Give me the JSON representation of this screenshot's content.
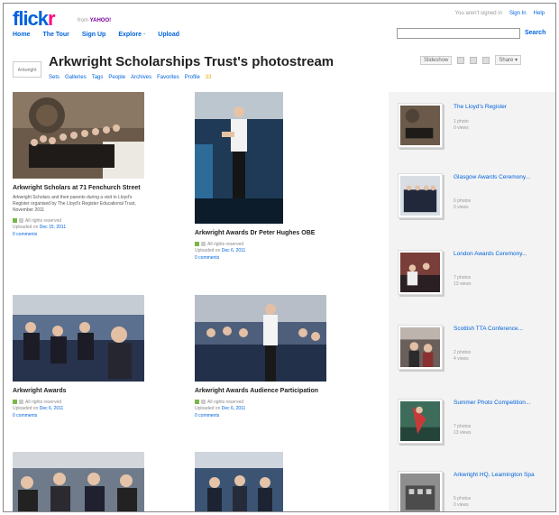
{
  "header": {
    "logo_main": "flick",
    "logo_r": "r",
    "logo_from": "from",
    "logo_yahoo": "YAHOO!",
    "nav": [
      "Home",
      "The Tour",
      "Sign Up",
      "Explore ·",
      "Upload"
    ],
    "not_signed_in": "You aren't signed in",
    "sign_in": "Sign In",
    "help": "Help",
    "search_label": "Search"
  },
  "profile": {
    "buddy_label": "Arkwright",
    "title": "Arkwright Scholarships Trust's photostream",
    "subnav": [
      "Sets",
      "Galleries",
      "Tags",
      "People",
      "Archives",
      "Favorites",
      "Profile"
    ],
    "subnav_count": "33",
    "slideshow": "Slideshow",
    "share": "Share ▾"
  },
  "photos": [
    {
      "title": "Arkwright Scholars at 71 Fenchurch Street",
      "desc": "Arkwright Scholars and their parents during a visit to Lloyd's Register organised by The Lloyd's Register Educational Trust, November 2011",
      "rights": "All rights reserved",
      "uploaded": "Uploaded on",
      "date": "Dec 15, 2011",
      "comments": "0 comments"
    },
    {
      "title": "Arkwright Awards Dr Peter Hughes OBE",
      "desc": "",
      "rights": "All rights reserved",
      "uploaded": "Uploaded on",
      "date": "Dec 6, 2011",
      "comments": "0 comments"
    },
    {
      "title": "Arkwright Awards",
      "desc": "",
      "rights": "All rights reserved",
      "uploaded": "Uploaded on",
      "date": "Dec 6, 2011",
      "comments": "0 comments"
    },
    {
      "title": "Arkwright Awards Audience Participation",
      "desc": "",
      "rights": "All rights reserved",
      "uploaded": "Uploaded on",
      "date": "Dec 6, 2011",
      "comments": "0 comments"
    }
  ],
  "sets": [
    {
      "name": "The Lloyd's Register",
      "photos": "1 photo",
      "views": "0 views"
    },
    {
      "name": "Glasgow Awards Ceremony...",
      "photos": "6 photos",
      "views": "0 views"
    },
    {
      "name": "London Awards Ceremony...",
      "photos": "7 photos",
      "views": "13 views"
    },
    {
      "name": "Scottish TTA Conference...",
      "photos": "2 photos",
      "views": "4 views"
    },
    {
      "name": "Summer Photo Competition...",
      "photos": "7 photos",
      "views": "13 views"
    },
    {
      "name": "Arkwright HQ, Leamington Spa",
      "photos": "5 photos",
      "views": "0 views"
    }
  ]
}
